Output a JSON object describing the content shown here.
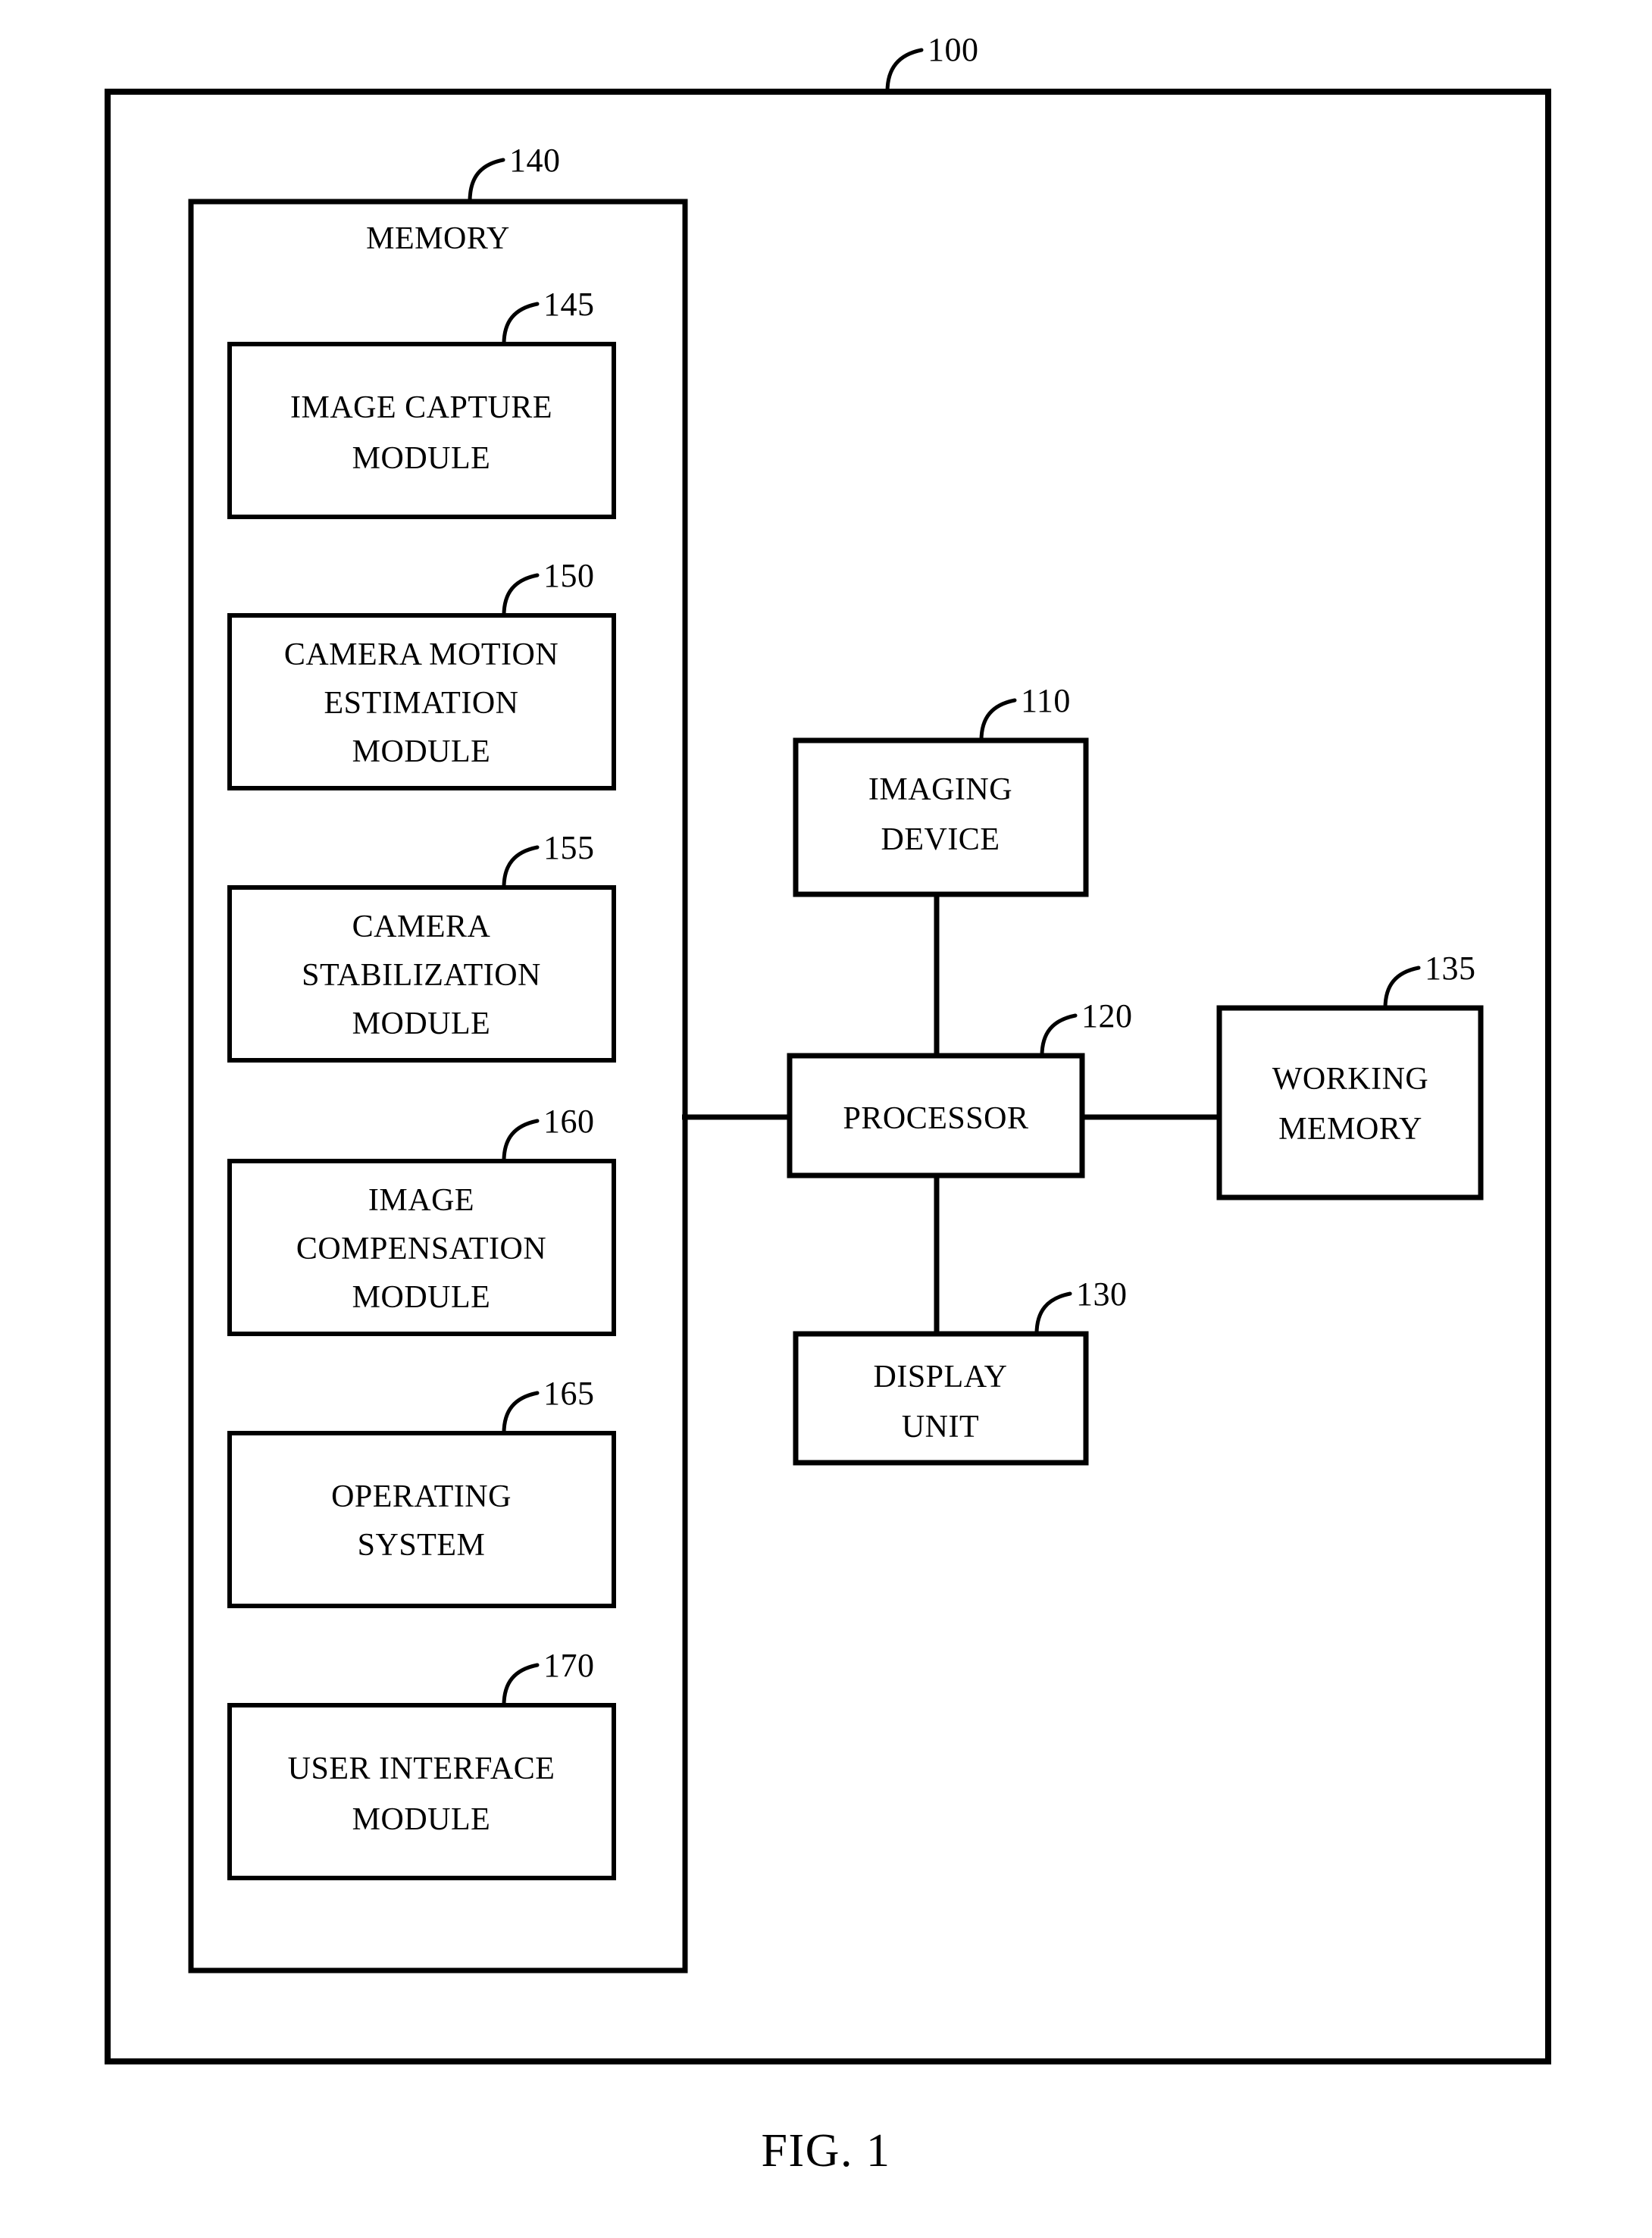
{
  "figure": {
    "caption": "FIG. 1",
    "system_ref": "100"
  },
  "outer_system": {
    "ref": "100"
  },
  "memory": {
    "title": "MEMORY",
    "ref": "140",
    "modules": [
      {
        "ref": "145",
        "lines": [
          "IMAGE CAPTURE",
          "MODULE"
        ]
      },
      {
        "ref": "150",
        "lines": [
          "CAMERA MOTION",
          "ESTIMATION",
          "MODULE"
        ]
      },
      {
        "ref": "155",
        "lines": [
          "CAMERA",
          "STABILIZATION",
          "MODULE"
        ]
      },
      {
        "ref": "160",
        "lines": [
          "IMAGE",
          "COMPENSATION",
          "MODULE"
        ]
      },
      {
        "ref": "165",
        "lines": [
          "OPERATING",
          "SYSTEM"
        ]
      },
      {
        "ref": "170",
        "lines": [
          "USER INTERFACE",
          "MODULE"
        ]
      }
    ]
  },
  "imaging_device": {
    "ref": "110",
    "lines": [
      "IMAGING",
      "DEVICE"
    ]
  },
  "processor": {
    "ref": "120",
    "lines": [
      "PROCESSOR"
    ]
  },
  "working_memory": {
    "ref": "135",
    "lines": [
      "WORKING",
      "MEMORY"
    ]
  },
  "display_unit": {
    "ref": "130",
    "lines": [
      "DISPLAY",
      "UNIT"
    ]
  },
  "colors": {
    "stroke": "#000000",
    "background": "#ffffff"
  }
}
